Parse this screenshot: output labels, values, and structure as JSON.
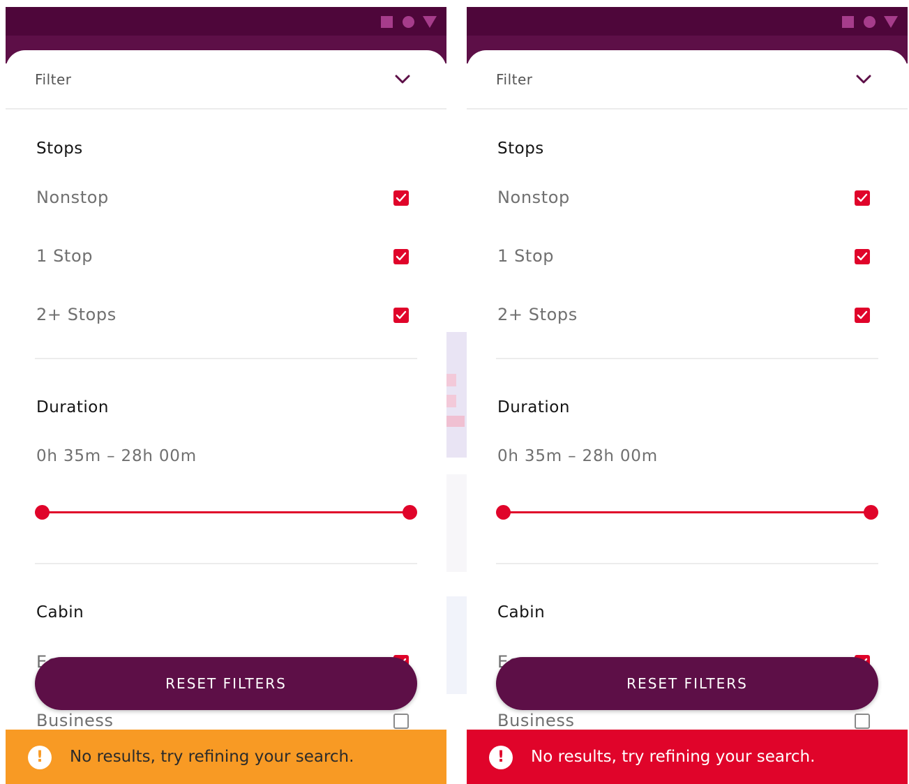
{
  "screens": [
    {
      "id": "left",
      "status_icons": [
        "square-icon",
        "circle-icon",
        "triangle-icon"
      ],
      "filter": {
        "title": "Filter",
        "toggle_icon": "chevron-down-icon"
      },
      "stops": {
        "title": "Stops",
        "options": [
          {
            "label": "Nonstop",
            "checked": true
          },
          {
            "label": "1 Stop",
            "checked": true
          },
          {
            "label": "2+ Stops",
            "checked": true
          }
        ]
      },
      "duration": {
        "title": "Duration",
        "range_text": "0h 35m – 28h 00m",
        "min_fraction": 0,
        "max_fraction": 1
      },
      "cabin": {
        "title": "Cabin",
        "options": [
          {
            "label": "Economy",
            "checked": true
          },
          {
            "label": "Business",
            "checked": false
          }
        ]
      },
      "reset_label": "RESET FILTERS",
      "banner": {
        "icon": "exclamation-icon",
        "icon_glyph": "!",
        "message": "No results, try refining your search.",
        "color": "#f89a24"
      }
    },
    {
      "id": "right",
      "status_icons": [
        "square-icon",
        "circle-icon",
        "triangle-icon"
      ],
      "filter": {
        "title": "Filter",
        "toggle_icon": "chevron-down-icon"
      },
      "stops": {
        "title": "Stops",
        "options": [
          {
            "label": "Nonstop",
            "checked": true
          },
          {
            "label": "1 Stop",
            "checked": true
          },
          {
            "label": "2+ Stops",
            "checked": true
          }
        ]
      },
      "duration": {
        "title": "Duration",
        "range_text": "0h 35m – 28h 00m",
        "min_fraction": 0,
        "max_fraction": 1
      },
      "cabin": {
        "title": "Cabin",
        "options": [
          {
            "label": "Economy",
            "checked": true
          },
          {
            "label": "Business",
            "checked": false
          }
        ]
      },
      "reset_label": "RESET FILTERS",
      "banner": {
        "icon": "exclamation-icon",
        "icon_glyph": "!",
        "message": "No results, try refining your search.",
        "color": "#e0042a"
      }
    }
  ],
  "theme": {
    "status_bar": "#4e063a",
    "app_bar": "#5d0f47",
    "accent_red": "#e0042a",
    "button": "#5d0f47"
  }
}
